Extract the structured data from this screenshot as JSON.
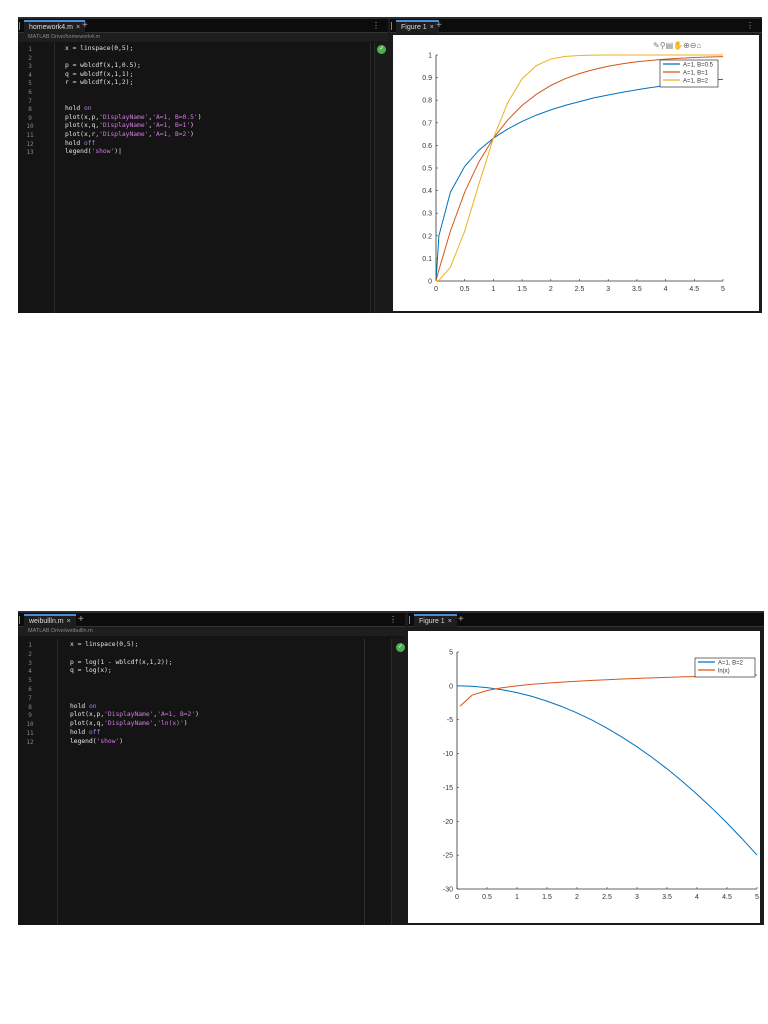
{
  "shot1": {
    "editor": {
      "tab": "homework4.m",
      "path": "MATLAB Drive/homework4.m",
      "lines": [
        [
          [
            "x = linspace(0,5);",
            ""
          ]
        ],
        [],
        [
          [
            "p = wblcdf(x,1,0.5);",
            ""
          ]
        ],
        [
          [
            "q = wblcdf(x,1,1);",
            ""
          ]
        ],
        [
          [
            "r = wblcdf(x,1,2);",
            ""
          ]
        ],
        [],
        [],
        [
          [
            "hold ",
            ""
          ],
          [
            "on",
            "kw"
          ]
        ],
        [
          [
            "plot(x,p,",
            ""
          ],
          [
            "'DisplayName'",
            "st"
          ],
          [
            ",",
            ""
          ],
          [
            "'A=1, B=0.5'",
            "st"
          ],
          [
            ")",
            ""
          ]
        ],
        [
          [
            "plot(x,q,",
            ""
          ],
          [
            "'DisplayName'",
            "st"
          ],
          [
            ",",
            ""
          ],
          [
            "'A=1, B=1'",
            "st"
          ],
          [
            ")",
            ""
          ]
        ],
        [
          [
            "plot(x,r,",
            ""
          ],
          [
            "'DisplayName'",
            "st"
          ],
          [
            ",",
            ""
          ],
          [
            "'A=1, B=2'",
            "st"
          ],
          [
            ")",
            ""
          ]
        ],
        [
          [
            "hold ",
            ""
          ],
          [
            "off",
            "kw"
          ]
        ],
        [
          [
            "legend(",
            ""
          ],
          [
            "'show'",
            "st"
          ],
          [
            ")|",
            ""
          ]
        ]
      ]
    },
    "figure": {
      "tab": "Figure 1"
    }
  },
  "shot2": {
    "editor": {
      "tab": "weibullln.m",
      "path": "MATLAB Drive/weibullln.m",
      "lines": [
        [
          [
            "x = linspace(0,5);",
            ""
          ]
        ],
        [],
        [
          [
            "p = log(1 - wblcdf(x,1,2));",
            ""
          ]
        ],
        [
          [
            "q = log(x);",
            ""
          ]
        ],
        [],
        [],
        [],
        [
          [
            "hold ",
            ""
          ],
          [
            "on",
            "kw"
          ]
        ],
        [
          [
            "plot(x,p,",
            ""
          ],
          [
            "'DisplayName'",
            "st"
          ],
          [
            ",",
            ""
          ],
          [
            "'A=1, B=2'",
            "st"
          ],
          [
            ")",
            ""
          ]
        ],
        [
          [
            "plot(x,q,",
            ""
          ],
          [
            "'DisplayName'",
            "st"
          ],
          [
            ",",
            ""
          ],
          [
            "'ln(x)'",
            "st"
          ],
          [
            ")",
            ""
          ]
        ],
        [
          [
            "hold ",
            ""
          ],
          [
            "off",
            "kw"
          ]
        ],
        [
          [
            "legend(",
            ""
          ],
          [
            "'show'",
            "st"
          ],
          [
            ")",
            ""
          ]
        ]
      ]
    },
    "figure": {
      "tab": "Figure 1"
    }
  },
  "chart_data": [
    {
      "type": "line",
      "title": "",
      "xlabel": "",
      "ylabel": "",
      "xlim": [
        0,
        5
      ],
      "ylim": [
        0,
        1
      ],
      "xticks": [
        "0",
        "0.5",
        "1",
        "1.5",
        "2",
        "2.5",
        "3",
        "3.5",
        "4",
        "4.5",
        "5"
      ],
      "yticks": [
        "0",
        "0.1",
        "0.2",
        "0.3",
        "0.4",
        "0.5",
        "0.6",
        "0.7",
        "0.8",
        "0.9",
        "1"
      ],
      "legend_position": "top-right",
      "x": [
        0,
        0.05,
        0.25,
        0.5,
        0.75,
        1,
        1.25,
        1.5,
        1.75,
        2,
        2.25,
        2.5,
        2.75,
        3,
        3.25,
        3.5,
        3.75,
        4,
        4.25,
        4.5,
        4.75,
        5
      ],
      "series": [
        {
          "name": "A=1, B=0.5",
          "color": "#0072bd",
          "values": [
            0,
            0.2,
            0.393,
            0.507,
            0.579,
            0.632,
            0.673,
            0.706,
            0.734,
            0.757,
            0.777,
            0.794,
            0.81,
            0.823,
            0.835,
            0.846,
            0.856,
            0.865,
            0.873,
            0.88,
            0.887,
            0.893
          ]
        },
        {
          "name": "A=1, B=1",
          "color": "#d95319",
          "values": [
            0,
            0.049,
            0.221,
            0.393,
            0.528,
            0.632,
            0.713,
            0.777,
            0.826,
            0.865,
            0.895,
            0.918,
            0.936,
            0.95,
            0.961,
            0.97,
            0.976,
            0.982,
            0.986,
            0.989,
            0.991,
            0.993
          ]
        },
        {
          "name": "A=1, B=2",
          "color": "#edb120",
          "values": [
            0,
            0.0025,
            0.061,
            0.221,
            0.43,
            0.632,
            0.79,
            0.895,
            0.953,
            0.982,
            0.994,
            0.998,
            0.9995,
            1,
            1,
            1,
            1,
            1,
            1,
            1,
            1,
            1
          ]
        }
      ]
    },
    {
      "type": "line",
      "title": "",
      "xlabel": "",
      "ylabel": "",
      "xlim": [
        0,
        5
      ],
      "ylim": [
        -30,
        5
      ],
      "xticks": [
        "0",
        "0.5",
        "1",
        "1.5",
        "2",
        "2.5",
        "3",
        "3.5",
        "4",
        "4.5",
        "5"
      ],
      "yticks": [
        "-30",
        "-25",
        "-20",
        "-15",
        "-10",
        "-5",
        "0",
        "5"
      ],
      "legend_position": "top-right",
      "x": [
        0,
        0.05,
        0.25,
        0.5,
        0.75,
        1,
        1.25,
        1.5,
        1.75,
        2,
        2.25,
        2.5,
        2.75,
        3,
        3.25,
        3.5,
        3.75,
        4,
        4.25,
        4.5,
        4.75,
        5
      ],
      "series": [
        {
          "name": "A=1, B=2",
          "color": "#0072bd",
          "values": [
            0,
            -0.0025,
            -0.0625,
            -0.25,
            -0.5625,
            -1,
            -1.5625,
            -2.25,
            -3.0625,
            -4,
            -5.0625,
            -6.25,
            -7.5625,
            -9,
            -10.5625,
            -12.25,
            -14.0625,
            -16,
            -18.0625,
            -20.25,
            -22.5625,
            -25
          ]
        },
        {
          "name": "ln(x)",
          "color": "#d95319",
          "values": [
            null,
            -3.0,
            -1.386,
            -0.693,
            -0.288,
            0,
            0.223,
            0.405,
            0.56,
            0.693,
            0.811,
            0.916,
            1.012,
            1.099,
            1.179,
            1.253,
            1.322,
            1.386,
            1.447,
            1.504,
            1.558,
            1.609
          ]
        }
      ]
    }
  ]
}
